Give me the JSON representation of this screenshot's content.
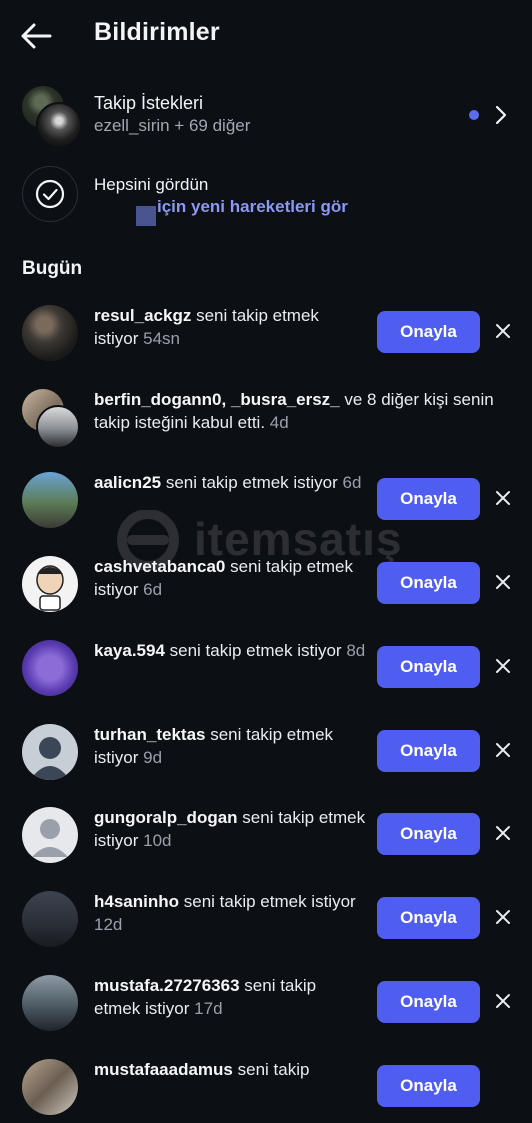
{
  "header": {
    "title": "Bildirimler"
  },
  "requests": {
    "title": "Takip İstekleri",
    "subtitle": "ezell_sirin + 69 diğer"
  },
  "seen": {
    "title": "Hepsini gördün",
    "link": "için yeni hareketleri gör"
  },
  "section": "Bugün",
  "watermark": "itemsatış",
  "approve_label": "Onayla",
  "notifications": [
    {
      "user": "resul_ackgz",
      "text": "seni takip etmek istiyor",
      "time": "54sn",
      "has_button": true
    },
    {
      "user": "berfin_dogann0, _busra_ersz_",
      "text": "ve 8 diğer kişi senin takip isteğini kabul etti.",
      "time": "4d",
      "has_button": false
    },
    {
      "user": "aalicn25",
      "text": "seni takip etmek istiyor",
      "time": "6d",
      "has_button": true
    },
    {
      "user": "cashvetabanca0",
      "text": "seni takip etmek istiyor",
      "time": "6d",
      "has_button": true
    },
    {
      "user": "kaya.594",
      "text": "seni takip etmek istiyor",
      "time": "8d",
      "has_button": true
    },
    {
      "user": "turhan_tektas",
      "text": "seni takip etmek istiyor",
      "time": "9d",
      "has_button": true
    },
    {
      "user": "gungoralp_dogan",
      "text": "seni takip etmek istiyor",
      "time": "10d",
      "has_button": true
    },
    {
      "user": "h4saninho",
      "text": "seni takip etmek istiyor",
      "time": "12d",
      "has_button": true
    },
    {
      "user": "mustafa.27276363",
      "text": "seni takip etmek istiyor",
      "time": "17d",
      "has_button": true
    },
    {
      "user": "mustafaaadamus",
      "text": "seni takip",
      "time": "",
      "has_button": true
    }
  ],
  "colors": {
    "background": "#0c0f14",
    "accent": "#4f5ef0",
    "link": "#8b98f6",
    "unread_dot": "#5b6cf0"
  },
  "icons": {
    "back": "arrow-left-icon",
    "chevron": "chevron-right-icon",
    "check": "check-circle-icon",
    "dismiss": "close-icon"
  }
}
